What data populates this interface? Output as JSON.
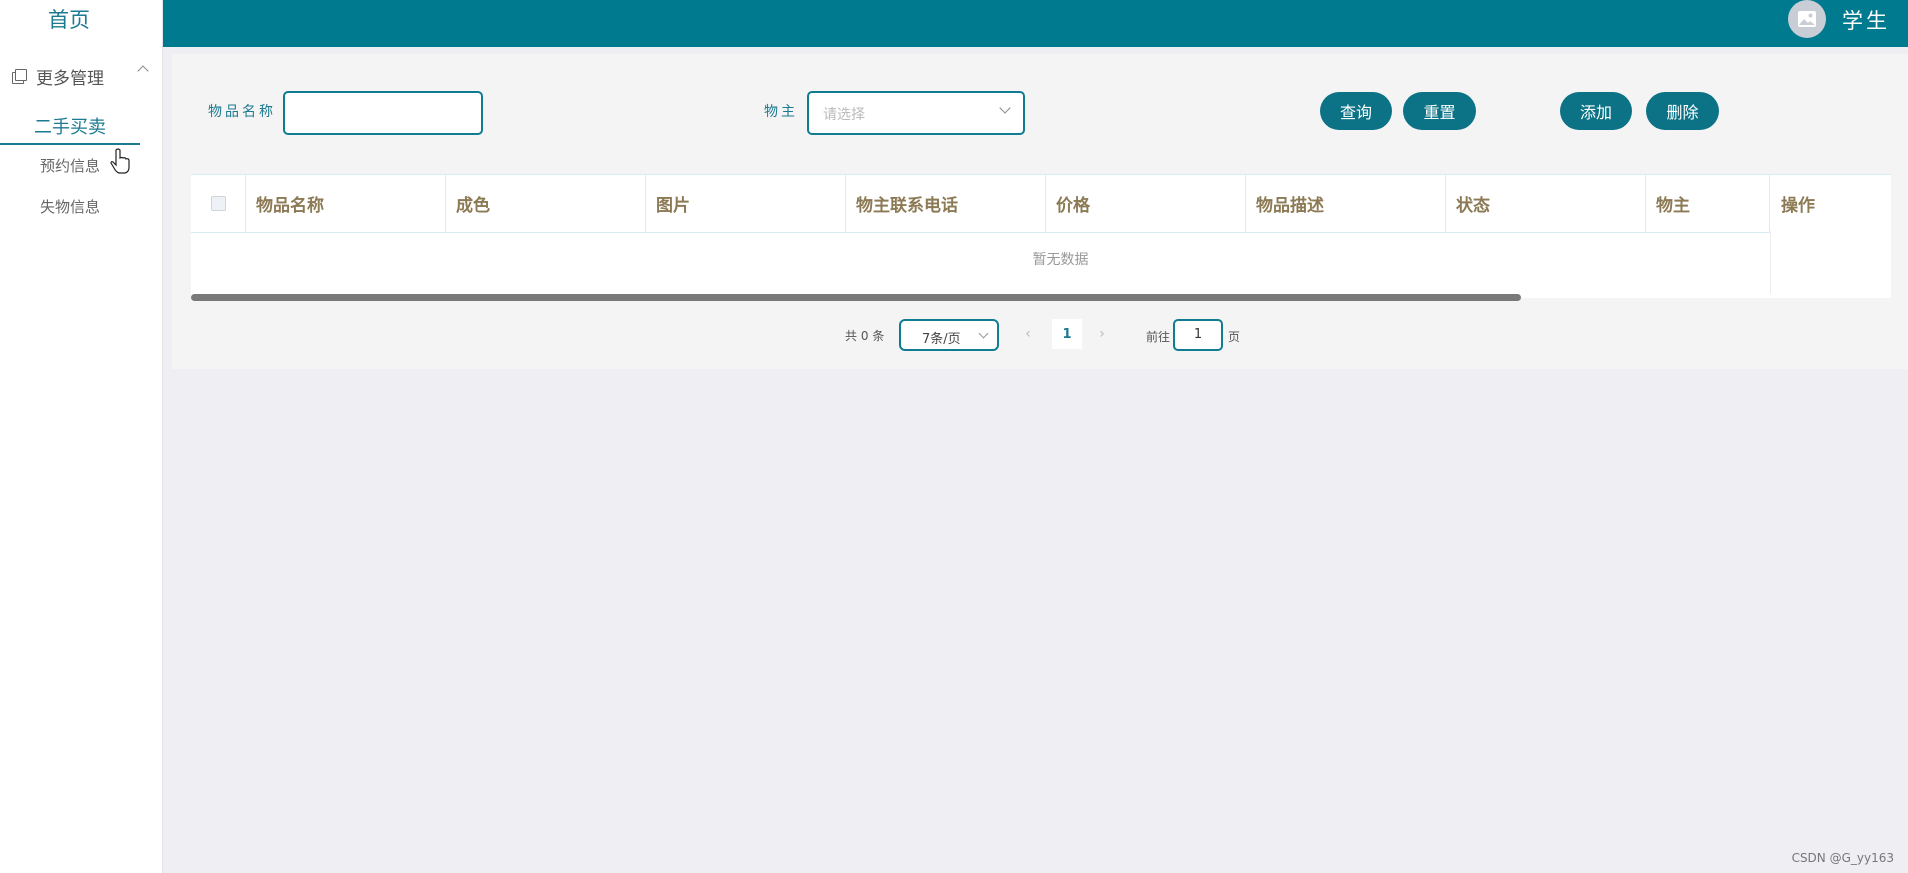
{
  "sidebar": {
    "home": "首页",
    "group_label": "更多管理",
    "items": [
      {
        "label": "二手买卖",
        "active": true
      },
      {
        "label": "预约信息",
        "active": false
      },
      {
        "label": "失物信息",
        "active": false
      }
    ]
  },
  "topbar": {
    "user_label": "学生",
    "avatar_icon": "image-icon",
    "color": "#007a8f"
  },
  "search": {
    "name_label": "物品名称",
    "name_value": "",
    "owner_label": "物主",
    "owner_placeholder": "请选择"
  },
  "buttons": {
    "query": "查询",
    "reset": "重置",
    "add": "添加",
    "delete": "删除"
  },
  "table": {
    "columns": [
      "物品名称",
      "成色",
      "图片",
      "物主联系电话",
      "价格",
      "物品描述",
      "状态",
      "物主",
      "操作"
    ],
    "empty_text": "暂无数据"
  },
  "pagination": {
    "total_prefix": "共",
    "total": "0",
    "total_suffix": "条",
    "page_size": "7条/页",
    "current_page": "1",
    "jump_prefix": "前往",
    "jump_value": "1",
    "jump_suffix": "页"
  },
  "watermark": "CSDN @G_yy163"
}
